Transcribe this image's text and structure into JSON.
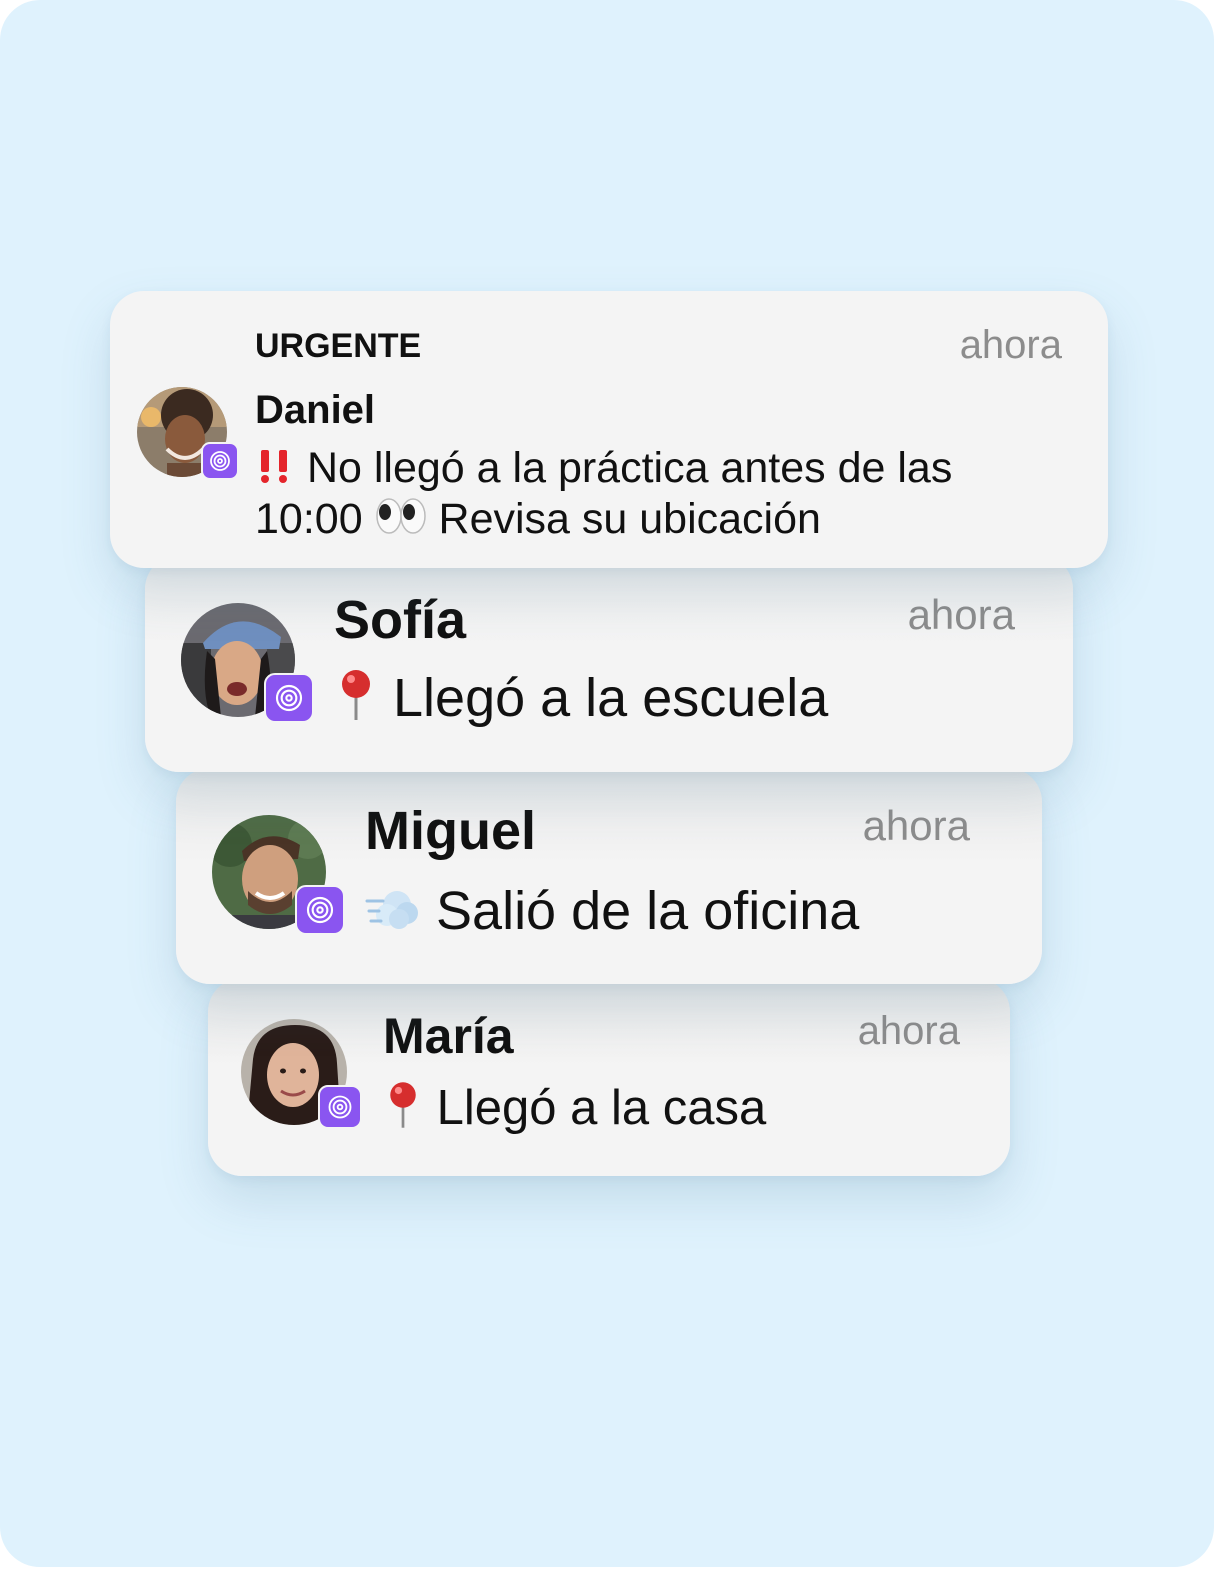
{
  "colors": {
    "background": "#dff2fd",
    "card": "#f4f4f4",
    "badge": "#8a55f0",
    "time_text": "#8c8c8c",
    "urgent_mark": "#e4242b",
    "pin": "#d62e2e"
  },
  "app_icon": "location-app-icon",
  "notifications": [
    {
      "label": "URGENTE",
      "name": "Daniel",
      "time": "ahora",
      "emoji_before": "double-exclamation-icon",
      "message_line1": "No llegó a la práctica antes de las",
      "message_line2_a": "10:00",
      "emoji_mid": "eyes-icon",
      "message_line2_b": "Revisa su ubicación"
    },
    {
      "name": "Sofía",
      "time": "ahora",
      "emoji": "round-pushpin-icon",
      "message": "Llegó a la escuela"
    },
    {
      "name": "Miguel",
      "time": "ahora",
      "emoji": "dash-cloud-icon",
      "message": "Salió de la oficina"
    },
    {
      "name": "María",
      "time": "ahora",
      "emoji": "round-pushpin-icon",
      "message": "Llegó a la casa"
    }
  ]
}
